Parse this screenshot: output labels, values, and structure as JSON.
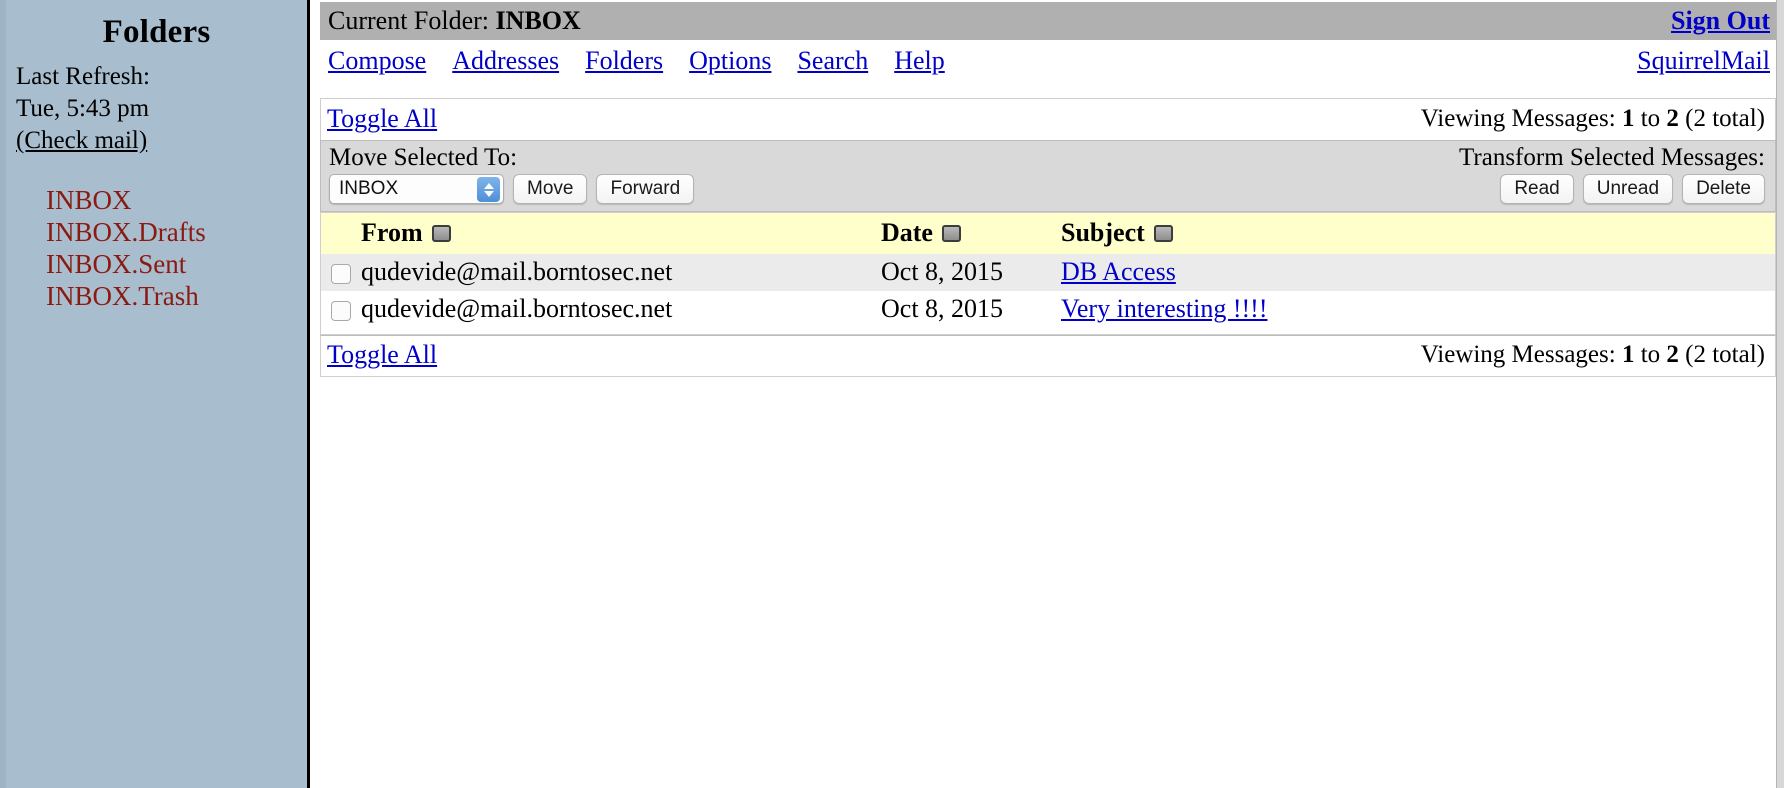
{
  "sidebar": {
    "title": "Folders",
    "last_refresh_label": "Last Refresh:",
    "last_refresh_time": "Tue, 5:43 pm",
    "check_mail_link": "(Check mail)",
    "folders": [
      {
        "label": "INBOX"
      },
      {
        "label": "INBOX.Drafts"
      },
      {
        "label": "INBOX.Sent"
      },
      {
        "label": "INBOX.Trash"
      }
    ],
    "folder_color": "#8b1a10",
    "background_color": "#a8bdcd"
  },
  "header": {
    "current_folder_label": "Current Folder:",
    "current_folder_name": "INBOX",
    "sign_out": "Sign Out",
    "brand": "SquirrelMail",
    "bar_color": "#b0b0b0",
    "link_color": "#0000c8"
  },
  "nav": {
    "items": [
      {
        "label": "Compose"
      },
      {
        "label": "Addresses"
      },
      {
        "label": "Folders"
      },
      {
        "label": "Options"
      },
      {
        "label": "Search"
      },
      {
        "label": "Help"
      }
    ]
  },
  "list_controls": {
    "toggle_all": "Toggle All",
    "viewing_prefix": "Viewing Messages:",
    "viewing_from": "1",
    "viewing_to_word": "to",
    "viewing_to": "2",
    "viewing_total": "(2 total)"
  },
  "toolbar": {
    "move_label": "Move Selected To:",
    "folder_select_value": "INBOX",
    "folder_select_options": [
      "INBOX",
      "INBOX.Drafts",
      "INBOX.Sent",
      "INBOX.Trash"
    ],
    "move_button": "Move",
    "forward_button": "Forward",
    "transform_label": "Transform Selected Messages:",
    "read_button": "Read",
    "unread_button": "Unread",
    "delete_button": "Delete",
    "background_color": "#d9d9d9"
  },
  "messages": {
    "columns": {
      "from": "From",
      "date": "Date",
      "subject": "Subject"
    },
    "header_background": "#ffffcc",
    "rows": [
      {
        "from": "qudevide@mail.borntosec.net",
        "date": "Oct 8, 2015",
        "subject": "DB Access"
      },
      {
        "from": "qudevide@mail.borntosec.net",
        "date": "Oct 8, 2015",
        "subject": "Very interesting !!!!"
      }
    ]
  }
}
